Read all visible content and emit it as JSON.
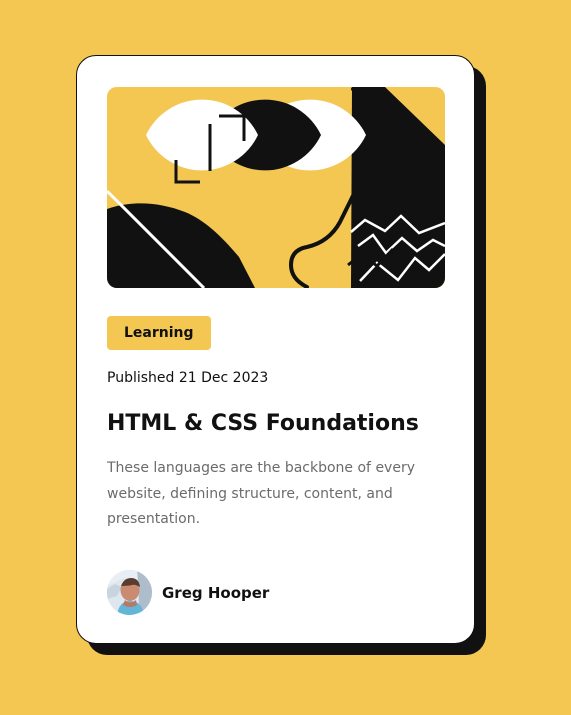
{
  "colors": {
    "background": "#F4C752",
    "card": "#FFFFFF",
    "ink": "#111111",
    "muted_text": "#6B6B6B",
    "badge": "#F4C752"
  },
  "card": {
    "hero_image": "abstract-yellow-black-white-illustration",
    "category": "Learning",
    "published_label": "Published 21 Dec 2023",
    "title": "HTML & CSS Foundations",
    "description": "These languages are the backbone of every website, defining structure, content, and presentation.",
    "author": {
      "avatar": "profile-photo",
      "name": "Greg Hooper"
    }
  }
}
